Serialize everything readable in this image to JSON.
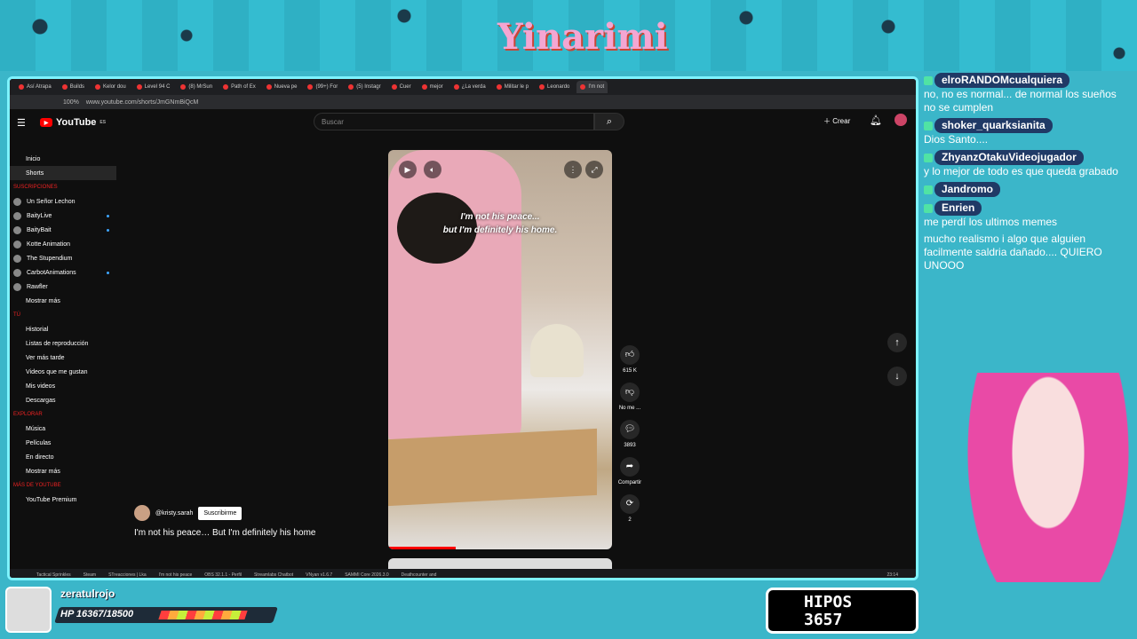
{
  "brand": {
    "logo_text": "Yinarimi"
  },
  "browser": {
    "tabs": [
      "Así Atrapa",
      "Builds",
      "Kelor dou",
      "Level 94 C",
      "(8) MrSun",
      "Path of Ex",
      "Nueva pe",
      "(99+) For",
      "(5) Instagr",
      "Cuer",
      "mejor",
      "¿La verda",
      "Militar le p",
      "Leonardo",
      "I'm not"
    ],
    "zoom": "100%",
    "url": "www.youtube.com/shorts/JmGNmBiQcM"
  },
  "youtube": {
    "logo": "YouTube",
    "logo_suffix": "ES",
    "search_placeholder": "Buscar",
    "create_label": "Crear",
    "sidebar": {
      "main": [
        {
          "label": "Inicio"
        },
        {
          "label": "Shorts"
        }
      ],
      "subs_header": "SUSCRIPCIONES",
      "channels": [
        {
          "name": "Un Señor Lechon",
          "live": false
        },
        {
          "name": "BaityLive",
          "live": true
        },
        {
          "name": "BaityBait",
          "live": true
        },
        {
          "name": "Kotte Animation",
          "live": false
        },
        {
          "name": "The Stupendium",
          "live": false
        },
        {
          "name": "CarbotAnimations",
          "live": true
        },
        {
          "name": "Rawfler",
          "live": false
        }
      ],
      "show_more": "Mostrar más",
      "you_header": "TÚ",
      "you_items": [
        "Historial",
        "Listas de reproducción",
        "Ver más tarde",
        "Videos que me gustan",
        "Mis videos",
        "Descargas"
      ],
      "explore_header": "EXPLORAR",
      "explore_items": [
        "Música",
        "Películas",
        "En directo",
        "Mostrar más"
      ],
      "more_header": "MÁS DE YOUTUBE",
      "more_items": [
        "YouTube Premium"
      ]
    },
    "short": {
      "caption_line1": "I'm not his peace...",
      "caption_line2": "but I'm definitely his home.",
      "channel": "@kristy.sarah",
      "subscribe": "Suscribirme",
      "title": "I'm not his peace… But I'm definitely his home",
      "likes": "615 K",
      "dislike_label": "No me ...",
      "comments": "3893",
      "share_label": "Compartir",
      "remix_count": "2"
    },
    "taskbar": [
      "Tactical Sprinkles",
      "Steam",
      "STreacciones | Lka",
      "I'm not his peace",
      "OBS 32.1.1 - Perfil",
      "Streamlabs Chatbot",
      "VNyan v1.6.7",
      "SAMMI Core 2026.3.0",
      "Deathcounter and"
    ],
    "clock": "23:14"
  },
  "chat": [
    {
      "user": "elroRANDOMcualquiera",
      "text": "no, no es normal... de normal los sueños no se cumplen"
    },
    {
      "user": "shoker_quarksianita",
      "text": "Dios Santo...."
    },
    {
      "user": "ZhyanzOtakuVideojugador",
      "text": "y lo mejor de todo es que queda grabado"
    },
    {
      "user": "Jandromo",
      "text": ""
    },
    {
      "user": "Enrien",
      "text": "me perdí los ultimos memes"
    },
    {
      "user": "",
      "text": "mucho realismo i algo que alguien facilmente saldria dañado.... QUIERO UNOOO"
    }
  ],
  "stats": {
    "player_name": "zeratulrojo",
    "hp_text": "HP 16367/18500",
    "hp_fraction": 0.885,
    "hipos_label": "HIPOS",
    "hipos_value": "3657"
  }
}
